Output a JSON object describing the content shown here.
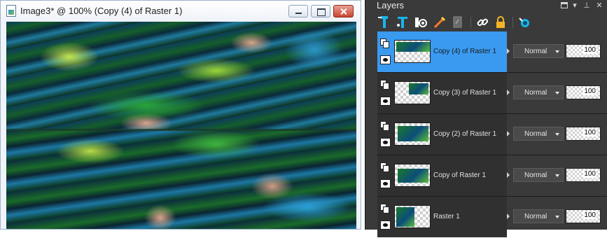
{
  "image_window": {
    "title": "Image3* @ 100% (Copy (4) of Raster 1)",
    "buttons": {
      "minimize": "minimize",
      "maximize": "maximize",
      "close": "close"
    }
  },
  "layers_palette": {
    "title": "Layers",
    "toolbar_icons": [
      "new-raster-layer-icon",
      "new-vector-layer-icon",
      "new-mask-layer-icon",
      "delete-layer-icon",
      "duplicate-layer-icon",
      "link-icon",
      "lock-icon",
      "visibility-toggle-icon"
    ],
    "layers": [
      {
        "name": "Copy (4) of Raster 1",
        "blend": "Normal",
        "opacity": "100",
        "selected": true
      },
      {
        "name": "Copy (3) of Raster 1",
        "blend": "Normal",
        "opacity": "100",
        "selected": false
      },
      {
        "name": "Copy (2) of Raster 1",
        "blend": "Normal",
        "opacity": "100",
        "selected": false
      },
      {
        "name": "Copy of Raster 1",
        "blend": "Normal",
        "opacity": "100",
        "selected": false
      },
      {
        "name": "Raster 1",
        "blend": "Normal",
        "opacity": "100",
        "selected": false
      }
    ]
  },
  "colors": {
    "selection": "#3a9af0",
    "palette_bg": "#3a3a3a",
    "accent_icon": "#19b5e8"
  }
}
